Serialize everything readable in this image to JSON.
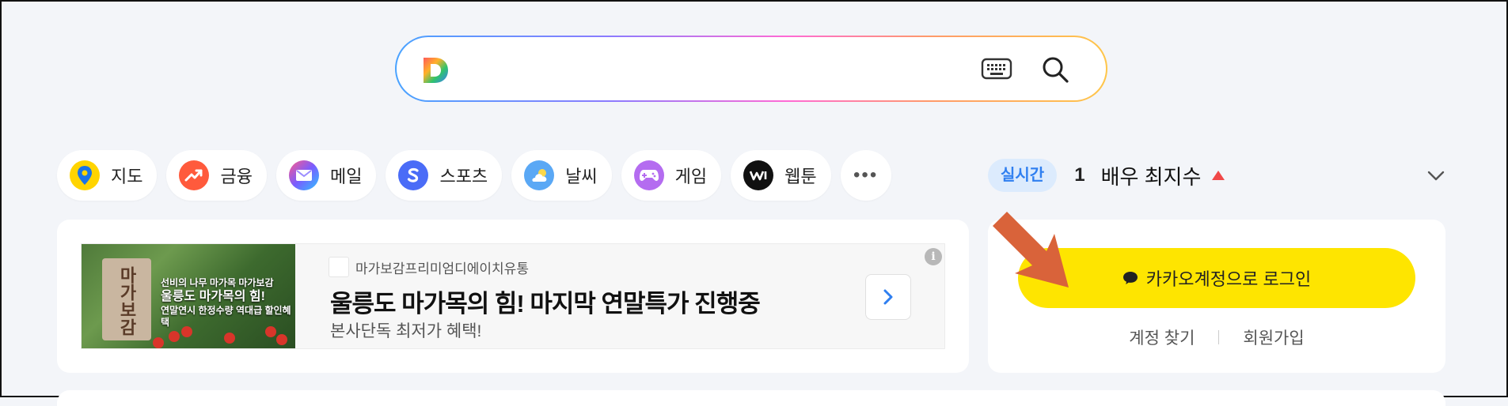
{
  "search": {
    "logo": "daum-d-logo",
    "placeholder": "",
    "keyboard_icon": "keyboard-icon",
    "search_icon": "search-icon"
  },
  "shortcuts": [
    {
      "label": "지도",
      "icon": "map-pin-icon",
      "color": "#ffd400"
    },
    {
      "label": "금융",
      "icon": "trend-up-icon",
      "color": "#ff5a3c"
    },
    {
      "label": "메일",
      "icon": "mail-icon",
      "color": "#7a5cff"
    },
    {
      "label": "스포츠",
      "icon": "sports-s-icon",
      "color": "#4a6cf7"
    },
    {
      "label": "날씨",
      "icon": "weather-icon",
      "color": "#5aa8f5"
    },
    {
      "label": "게임",
      "icon": "gamepad-icon",
      "color": "#b46cf0"
    },
    {
      "label": "웹툰",
      "icon": "webtoon-icon",
      "color": "#111111"
    },
    {
      "label": "•••",
      "icon": "more-icon"
    }
  ],
  "realtime": {
    "badge": "실시간",
    "rank": "1",
    "term": "배우 최지수",
    "trend": "up",
    "trend_color": "#f04848"
  },
  "ad": {
    "brand": "마가보감프리미엄디에이치유통",
    "title": "울릉도 마가목의 힘! 마지막 연말특가 진행중",
    "subtitle": "본사단독 최저가 혜택!",
    "image_text": {
      "package": "마가보감",
      "line1": "선비의 나무 마가목 마가보감",
      "line2": "울릉도 마가목의 힘!",
      "line3": "연말연시 한정수량 역대급 할인혜택"
    },
    "info": "i"
  },
  "login": {
    "button_label": "카카오계정으로 로그인",
    "button_color": "#fee500",
    "find_account": "계정 찾기",
    "signup": "회원가입"
  },
  "colors": {
    "background": "#f3f5f9",
    "accent_blue": "#2f7ff0",
    "annotation_arrow": "#d9633a"
  }
}
